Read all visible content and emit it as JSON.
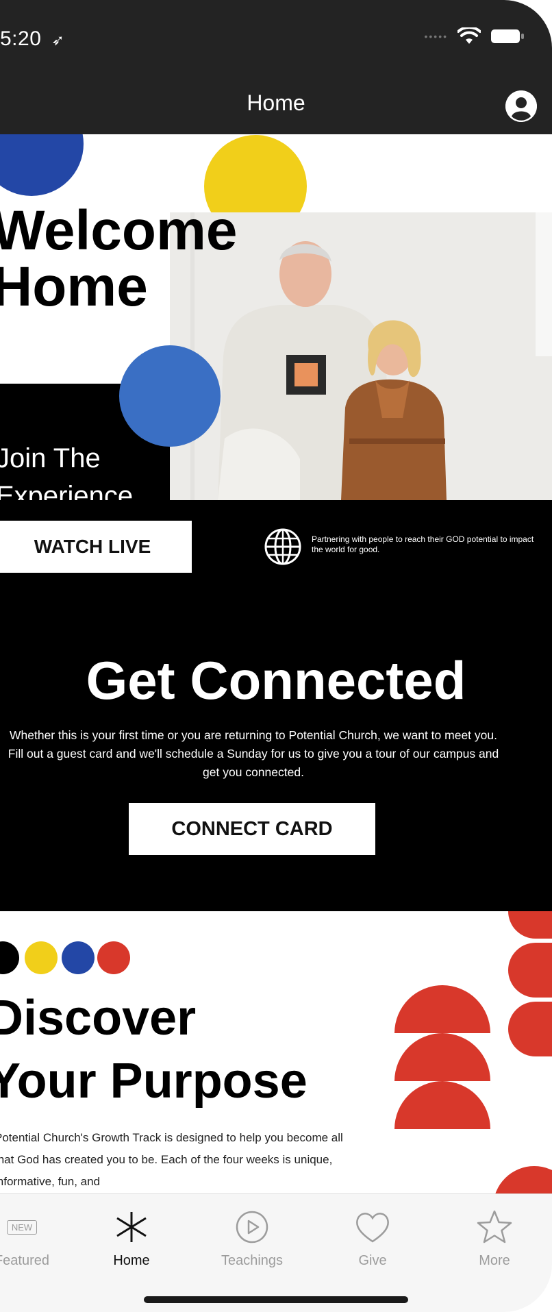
{
  "status": {
    "time": "5:20"
  },
  "navbar": {
    "title": "Home"
  },
  "hero": {
    "welcome_line1": "Welcome",
    "welcome_line2": "Home",
    "join_line1": "Join The",
    "join_line2": "Experience"
  },
  "watch": {
    "button_label": "WATCH LIVE",
    "partner_text": "Partnering with people to reach their GOD potential to impact the world for good."
  },
  "connect": {
    "title": "Get Connected",
    "body": "Whether this is your first time or you are returning to Potential Church, we want to meet you. Fill out a guest card and we'll schedule a Sunday for us to give you a tour of our campus and get you connected.",
    "button_label": "CONNECT CARD"
  },
  "discover": {
    "title_line1": "Discover",
    "title_line2": "Your Purpose",
    "body": "Potential Church's Growth Track is designed to help you become all that God has created you to be. Each of the four weeks is unique, informative, fun, and"
  },
  "tabs": [
    {
      "label": "Featured",
      "icon": "new-badge-icon",
      "badge": "NEW"
    },
    {
      "label": "Home",
      "icon": "asterisk-icon",
      "active": true
    },
    {
      "label": "Teachings",
      "icon": "play-circle-icon"
    },
    {
      "label": "Give",
      "icon": "heart-icon"
    },
    {
      "label": "More",
      "icon": "star-icon"
    }
  ],
  "colors": {
    "blue_dark": "#2347a6",
    "blue": "#3a6fc4",
    "yellow": "#f1cf1a",
    "red": "#d8382b",
    "bar": "#232323",
    "black": "#000000"
  }
}
